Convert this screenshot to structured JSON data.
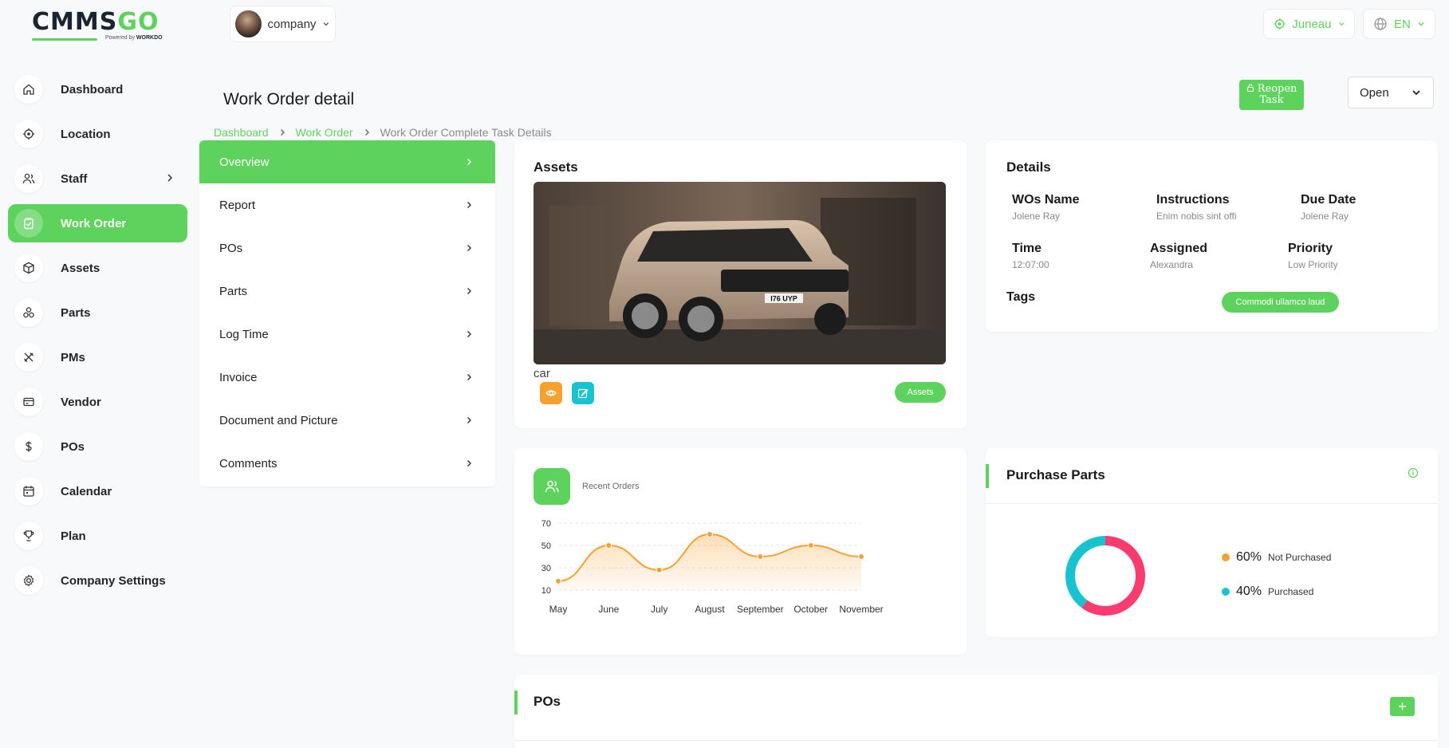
{
  "brand": {
    "logo_main": "CMMS",
    "logo_go": "GO",
    "powered_by": "Powered by",
    "powered_brand": "WORKDO"
  },
  "topbar": {
    "company_label": "company",
    "location_label": "Juneau",
    "language_label": "EN"
  },
  "sidebar": {
    "items": [
      {
        "label": "Dashboard",
        "icon": "home-icon"
      },
      {
        "label": "Location",
        "icon": "location-icon"
      },
      {
        "label": "Staff",
        "icon": "users-icon"
      },
      {
        "label": "Work Order",
        "icon": "clipboard-icon"
      },
      {
        "label": "Assets",
        "icon": "box-icon"
      },
      {
        "label": "Parts",
        "icon": "parts-icon"
      },
      {
        "label": "PMs",
        "icon": "tools-icon"
      },
      {
        "label": "Vendor",
        "icon": "card-icon"
      },
      {
        "label": "POs",
        "icon": "dollar-icon"
      },
      {
        "label": "Calendar",
        "icon": "calendar-icon"
      },
      {
        "label": "Plan",
        "icon": "trophy-icon"
      },
      {
        "label": "Company Settings",
        "icon": "gear-icon"
      }
    ]
  },
  "header": {
    "title": "Work Order detail",
    "breadcrumb": [
      "Dashboard",
      "Work Order",
      "Work Order Complete Task Details"
    ],
    "reopen_label": "Reopen Task",
    "status_value": "Open"
  },
  "tabs": [
    "Overview",
    "Report",
    "POs",
    "Parts",
    "Log Time",
    "Invoice",
    "Document and Picture",
    "Comments"
  ],
  "assets": {
    "title": "Assets",
    "name": "car",
    "plate": "I76 UYP",
    "button_label": "Assets"
  },
  "details": {
    "title": "Details",
    "wos_name_label": "WOs Name",
    "wos_name_value": "Jolene Ray",
    "instructions_label": "Instructions",
    "instructions_value": "Enim nobis sint offi",
    "due_date_label": "Due Date",
    "due_date_value": "Jolene Ray",
    "time_label": "Time",
    "time_value": "12:07:00",
    "assigned_label": "Assigned",
    "assigned_value": "Alexandra",
    "priority_label": "Priority",
    "priority_value": "Low Priority",
    "tags_label": "Tags",
    "tag_value": "Commodi ullamco laud"
  },
  "recent_orders": {
    "label": "Recent Orders"
  },
  "purchase_parts": {
    "title": "Purchase Parts",
    "legend": [
      {
        "pct": "60%",
        "label": "Not Purchased",
        "color": "#f5a031"
      },
      {
        "pct": "40%",
        "label": "Purchased",
        "color": "#17c3d0"
      }
    ]
  },
  "pos": {
    "title": "POs",
    "add_label": "+"
  },
  "chart_data": [
    {
      "type": "area",
      "x": [
        "May",
        "June",
        "July",
        "August",
        "September",
        "October",
        "November"
      ],
      "values": [
        18,
        50,
        28,
        60,
        40,
        50,
        40
      ],
      "ylim": [
        10,
        70
      ],
      "yticks": [
        10,
        30,
        50,
        70
      ],
      "color": "#f5a031",
      "grid": true
    },
    {
      "type": "pie",
      "donut": true,
      "slices": [
        {
          "label": "Not Purchased",
          "value": 60,
          "color": "#fb3a6e"
        },
        {
          "label": "Purchased",
          "value": 40,
          "color": "#17c3d0"
        }
      ]
    }
  ],
  "colors": {
    "accent": "#5dd35d",
    "orange": "#f5a031",
    "teal": "#17c3d0",
    "pink": "#fb3a6e"
  }
}
